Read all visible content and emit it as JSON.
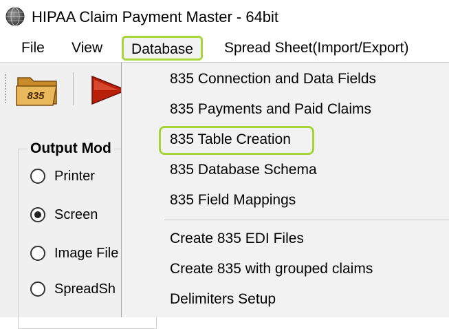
{
  "window": {
    "title": "HIPAA Claim Payment Master - 64bit",
    "icon": "app-globe-icon"
  },
  "menubar": {
    "items": [
      {
        "label": "File"
      },
      {
        "label": "View"
      },
      {
        "label": "Database",
        "active": true
      },
      {
        "label": "Spread Sheet(Import/Export)"
      }
    ]
  },
  "toolbar": {
    "open_835_label": "835",
    "icons": [
      "folder-835-icon",
      "play-icon"
    ]
  },
  "output_mode": {
    "title": "Output Mod",
    "options": [
      {
        "label": "Printer",
        "checked": false
      },
      {
        "label": "Screen",
        "checked": true
      },
      {
        "label": "Image File",
        "checked": false
      },
      {
        "label": "SpreadSh",
        "checked": false
      }
    ]
  },
  "database_menu": {
    "items": [
      {
        "label": "835 Connection and Data Fields"
      },
      {
        "label": "835 Payments and Paid Claims"
      },
      {
        "label": "835 Table Creation",
        "highlighted": true
      },
      {
        "label": "835 Database Schema"
      },
      {
        "label": "835 Field Mappings"
      },
      {
        "label": "Create 835 EDI Files"
      },
      {
        "label": "Create 835 with grouped claims"
      },
      {
        "label": "Delimiters Setup"
      }
    ]
  },
  "colors": {
    "highlight_outline": "#a6d63c",
    "menu_background": "#f2f2f2",
    "panel_background": "#f0f0f0",
    "play_arrow": "#b8200c",
    "folder": "#d9a441"
  }
}
